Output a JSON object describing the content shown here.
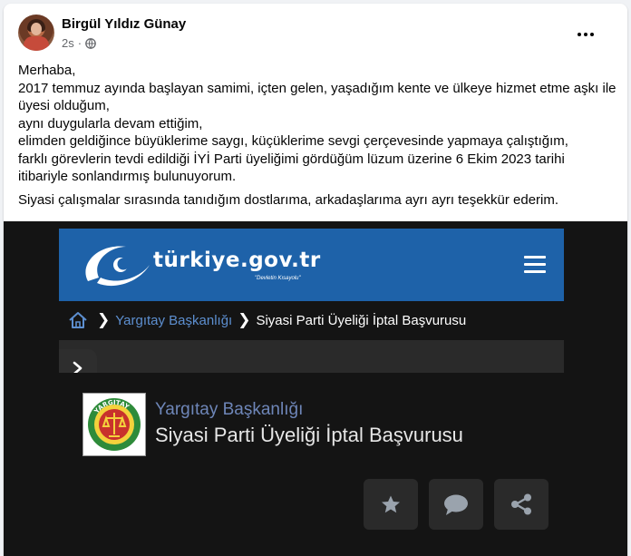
{
  "post": {
    "author": "Birgül Yıldız Günay",
    "time": "2s",
    "privacy_icon": "globe-icon",
    "menu_icon": "more-options-icon",
    "paragraphs": [
      "Merhaba,",
      "2017 temmuz ayında başlayan samimi, içten gelen, yaşadığım kente ve ülkeye hizmet etme aşkı ile",
      "üyesi olduğum,",
      "aynı duygularla devam ettiğim,",
      "elimden geldiğince büyüklerime saygı, küçüklerime sevgi çerçevesinde  yapmaya çalıştığım,",
      "farklı görevlerin tevdi edildiği İYİ Parti üyeliğimi gördüğüm lüzum üzerine 6 Ekim 2023 tarihi",
      "itibariyle sonlandırmış bulunuyorum."
    ],
    "closing": "Siyasi çalışmalar sırasında tanıdığım dostlarıma, arkadaşlarıma ayrı ayrı teşekkür ederim."
  },
  "screenshot": {
    "site_name": "türkiye.gov.tr",
    "tagline": "\"Devletin Kısayolu\"",
    "breadcrumb": {
      "home_icon": "home-icon",
      "link": "Yargıtay Başkanlığı",
      "current": "Siyasi Parti Üyeliği İptal Başvurusu"
    },
    "institution": "Yargıtay Başkanlığı",
    "institution_logo_text": "YARGITAY",
    "page_title": "Siyasi Parti Üyeliği İptal Başvurusu",
    "actions": [
      "star-icon",
      "comment-icon",
      "share-icon"
    ]
  },
  "colors": {
    "header_blue": "#1e62a9",
    "link_blue": "#5d8fd0",
    "dark_bg": "#141414"
  }
}
